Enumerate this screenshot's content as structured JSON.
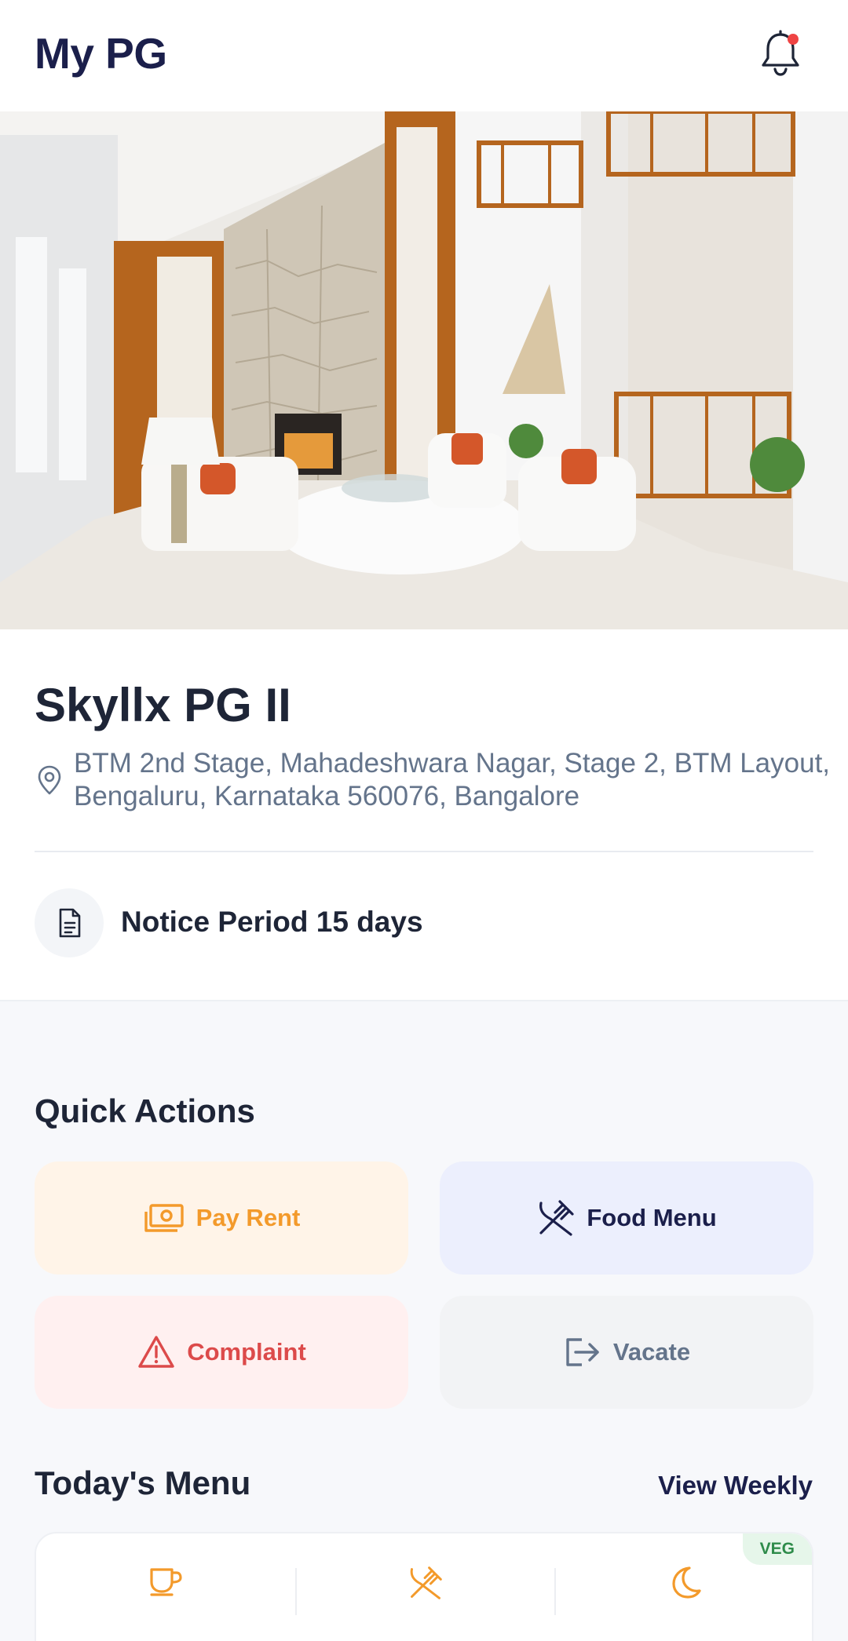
{
  "header": {
    "title": "My PG",
    "notification_icon": "bell-icon",
    "has_unread": true
  },
  "property": {
    "name": "Skyllx PG II",
    "address": "BTM 2nd Stage, Mahadeshwara Nagar, Stage 2, BTM Layout, Bengaluru, Karnataka 560076, Bangalore",
    "notice_period": "Notice Period 15 days"
  },
  "quick_actions": {
    "title": "Quick Actions",
    "items": [
      {
        "label": "Pay Rent",
        "icon": "cash-icon",
        "color": "#f39a2b"
      },
      {
        "label": "Food Menu",
        "icon": "fork-knife-icon",
        "color": "#1b1f4b"
      },
      {
        "label": "Complaint",
        "icon": "warning-icon",
        "color": "#dc4a4a"
      },
      {
        "label": "Vacate",
        "icon": "logout-icon",
        "color": "#64748b"
      }
    ]
  },
  "todays_menu": {
    "title": "Today's Menu",
    "view_weekly": "View Weekly",
    "badge": "VEG",
    "meal_icons": [
      "cup-icon",
      "fork-knife-icon",
      "moon-icon"
    ]
  },
  "colors": {
    "brand_navy": "#1b1f4b",
    "accent_orange": "#f39a2b",
    "danger_red": "#dc4a4a",
    "muted_gray": "#64748b",
    "veg_green": "#2e8b4a"
  }
}
